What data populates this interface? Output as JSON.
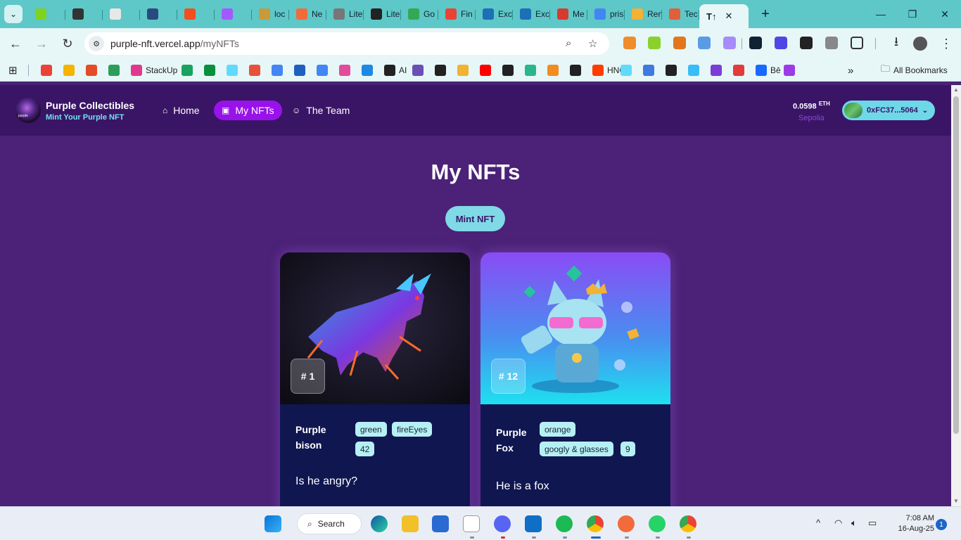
{
  "browser": {
    "tabs": [
      {
        "label": "",
        "color": "#7ed321"
      },
      {
        "label": "",
        "color": "#333333"
      },
      {
        "label": "",
        "color": "#e8e8e8"
      },
      {
        "label": "",
        "color": "#2a4a7f"
      },
      {
        "label": "",
        "color": "#f24e1e"
      },
      {
        "label": "",
        "color": "#a259ff"
      },
      {
        "label": "loc",
        "color": "#c79a3a"
      },
      {
        "label": "Ne",
        "color": "#f26b3a"
      },
      {
        "label": "Lite",
        "color": "#777777"
      },
      {
        "label": "Lite",
        "color": "#222222"
      },
      {
        "label": "Go",
        "color": "#34a853"
      },
      {
        "label": "Fin",
        "color": "#ea4335"
      },
      {
        "label": "Exc",
        "color": "#1d6fb8"
      },
      {
        "label": "Exc",
        "color": "#1d6fb8"
      },
      {
        "label": "Me",
        "color": "#d63b2f"
      },
      {
        "label": "pris",
        "color": "#4285f4"
      },
      {
        "label": "Ren",
        "color": "#f2b233"
      },
      {
        "label": "Tec",
        "color": "#e0603a"
      }
    ],
    "active_tab_icon": "T↑",
    "url_host": "purple-nft.vercel.app",
    "url_path": "/myNFTs",
    "bookmarks": [
      {
        "label": "",
        "color": "#ea4335"
      },
      {
        "label": "",
        "color": "#f5b400"
      },
      {
        "label": "",
        "color": "#e34c26"
      },
      {
        "label": "",
        "color": "#2d9d5b"
      },
      {
        "label": "StackUp",
        "color": "#e0388f"
      },
      {
        "label": "",
        "color": "#1aa260"
      },
      {
        "label": "",
        "color": "#0a8f3c"
      },
      {
        "label": "",
        "color": "#61dafb"
      },
      {
        "label": "",
        "color": "#e8513a"
      },
      {
        "label": "",
        "color": "#4285f4"
      },
      {
        "label": "",
        "color": "#1f5fbf"
      },
      {
        "label": "",
        "color": "#4285f4"
      },
      {
        "label": "",
        "color": "#e34c9a"
      },
      {
        "label": "",
        "color": "#1e88e5"
      },
      {
        "label": "AI",
        "color": "#222222"
      },
      {
        "label": "",
        "color": "#6a4fb5"
      },
      {
        "label": "",
        "color": "#222222"
      },
      {
        "label": "",
        "color": "#f2b233"
      },
      {
        "label": "",
        "color": "#ff0000"
      },
      {
        "label": "",
        "color": "#222222"
      },
      {
        "label": "",
        "color": "#2bb58a"
      },
      {
        "label": "",
        "color": "#f28b20"
      },
      {
        "label": "",
        "color": "#222222"
      },
      {
        "label": "HNG",
        "color": "#ff3d00"
      },
      {
        "label": "",
        "color": "#61dafb"
      },
      {
        "label": "",
        "color": "#3d7be0"
      },
      {
        "label": "",
        "color": "#222222"
      },
      {
        "label": "",
        "color": "#38bdf8"
      },
      {
        "label": "",
        "color": "#7a3dd6"
      },
      {
        "label": "",
        "color": "#e23b3b"
      },
      {
        "label": "Bē",
        "color": "#1769ff"
      },
      {
        "label": "",
        "color": "#9b3be8"
      }
    ],
    "all_bookmarks": "All Bookmarks",
    "more_bookmarks": "»"
  },
  "site": {
    "brand_name": "Purple Collectibles",
    "brand_tagline": "Mint Your Purple NFT",
    "logo_text": "purple",
    "nav": [
      {
        "label": "Home",
        "icon": "home-icon"
      },
      {
        "label": "My NFTs",
        "icon": "image-icon",
        "active": true
      },
      {
        "label": "The Team",
        "icon": "team-icon"
      }
    ],
    "balance_amount": "0.0598",
    "balance_unit": "ETH",
    "network": "Sepolia",
    "wallet_address": "0xFC37...5064",
    "colors": {
      "header": "#3a1566",
      "page": "#4b2277",
      "accent": "#9812ea",
      "cyan": "#7fd9e6"
    }
  },
  "main": {
    "title": "My NFTs",
    "mint_button": "Mint NFT",
    "nfts": [
      {
        "id": "# 1",
        "name_line1": "Purple",
        "name_line2": "bison",
        "tags": [
          "green",
          "fireEyes",
          "42"
        ],
        "description": "Is he angry?"
      },
      {
        "id": "# 12",
        "name_line1": "Purple",
        "name_line2": "Fox",
        "tags": [
          "orange",
          "googly & glasses",
          "9"
        ],
        "description": "He is a fox"
      }
    ]
  },
  "taskbar": {
    "search_label": "Search",
    "time": "7:08 AM",
    "date": "16-Aug-25",
    "notifications": "1"
  }
}
